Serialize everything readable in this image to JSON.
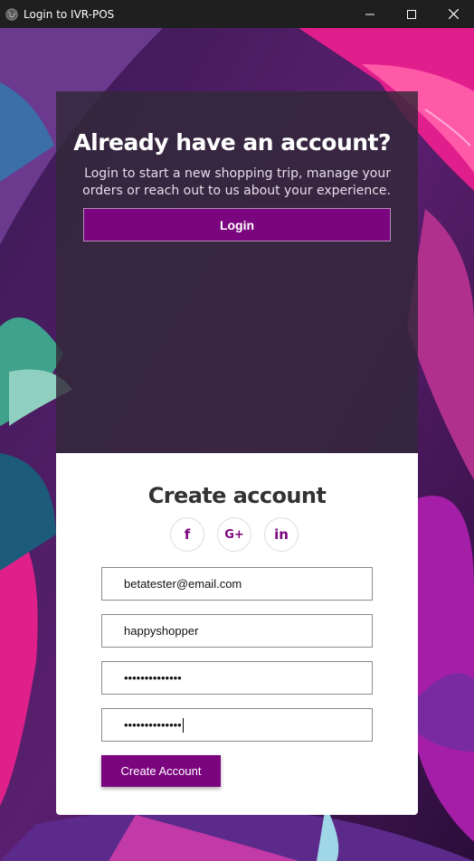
{
  "window": {
    "title": "Login to IVR-POS",
    "app_icon": "globe-icon",
    "controls": [
      "minimize-icon",
      "maximize-icon",
      "close-icon"
    ]
  },
  "signin_panel": {
    "heading": "Already have an account?",
    "description": "Login to start a new shopping trip, manage your orders or reach out to us about your experience.",
    "login_label": "Login"
  },
  "register_panel": {
    "heading": "Create account",
    "social": [
      {
        "name": "facebook-icon",
        "glyph": "f"
      },
      {
        "name": "google-plus-icon",
        "glyph": "G+"
      },
      {
        "name": "linkedin-icon",
        "glyph": "in"
      }
    ],
    "email_value": "betatester@email.com",
    "username_value": "happyshopper",
    "password_value": "••••••••••••••",
    "confirm_password_value": "••••••••••••••",
    "create_label": "Create Account"
  },
  "colors": {
    "accent": "#7b057e",
    "titlebar": "#1f1f1f",
    "panel": "#322838"
  }
}
